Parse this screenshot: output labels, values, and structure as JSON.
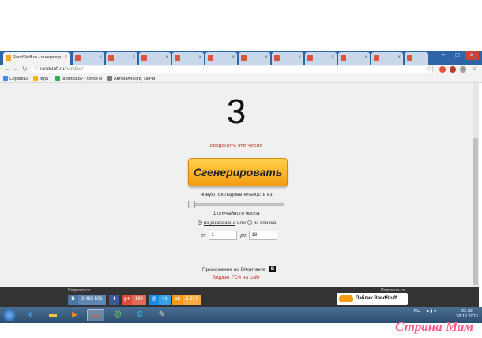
{
  "browser": {
    "tabs": [
      {
        "label": "RandStuff.ru - генератор",
        "active": true,
        "color": "#f5a623"
      },
      {
        "label": "",
        "active": false,
        "color": "#e0533d"
      },
      {
        "label": "",
        "active": false,
        "color": "#e0533d"
      },
      {
        "label": "",
        "active": false,
        "color": "#e0533d"
      },
      {
        "label": "",
        "active": false,
        "color": "#e0533d"
      },
      {
        "label": "",
        "active": false,
        "color": "#e0533d"
      },
      {
        "label": "",
        "active": false,
        "color": "#e0533d"
      },
      {
        "label": "",
        "active": false,
        "color": "#e0533d"
      }
    ],
    "address": {
      "host": "randstuff.ru",
      "path": "/number/"
    },
    "bookmarks": [
      {
        "label": "Сервисы",
        "color": "#4285f4"
      },
      {
        "label": "игра",
        "color": "#f4b400"
      },
      {
        "label": "tabletka.by - поиск м",
        "color": "#34a853"
      },
      {
        "label": "Автозапчасти, запча",
        "color": "#777777"
      }
    ]
  },
  "page": {
    "result_number": "3",
    "save_link": "сохранить это число",
    "generate_button": "Сгенерировать",
    "sequence_label": "новую последовательность из",
    "slider_value_fraction": 0.0,
    "count_label": "1 случайного числа",
    "range_option": "из диапазона",
    "or_word": "или",
    "list_option": "из списка",
    "from_label": "от",
    "from_value": "1",
    "to_label": "до",
    "to_value": "18",
    "vk_app_link": "Приложение во ВКонтакте",
    "vk_badge": "B",
    "widget_link": "Виджет ГСЧ на сайт"
  },
  "footer": {
    "share_title": "Поделиться:",
    "subscribe_title": "Подписаться:",
    "share_buttons": [
      {
        "icon": "vk-icon",
        "glyph": "B",
        "count": "2 483 501",
        "color": "#4a76a8"
      },
      {
        "icon": "facebook-icon",
        "glyph": "f",
        "count": "",
        "color": "#3b5998"
      },
      {
        "icon": "google-plus-icon",
        "glyph": "g+",
        "count": "184",
        "color": "#dd4b39"
      },
      {
        "icon": "mail-ru-icon",
        "glyph": "@",
        "count": "41",
        "color": "#168de2"
      },
      {
        "icon": "odnoklassniki-icon",
        "glyph": "ok",
        "count": "5 514",
        "color": "#f59a1a"
      }
    ],
    "public_button": "Паблик RandStuff"
  },
  "taskbar": {
    "language": "RU",
    "time": "22:52",
    "date": "28.12.2016"
  },
  "watermark": "Страна Мам"
}
